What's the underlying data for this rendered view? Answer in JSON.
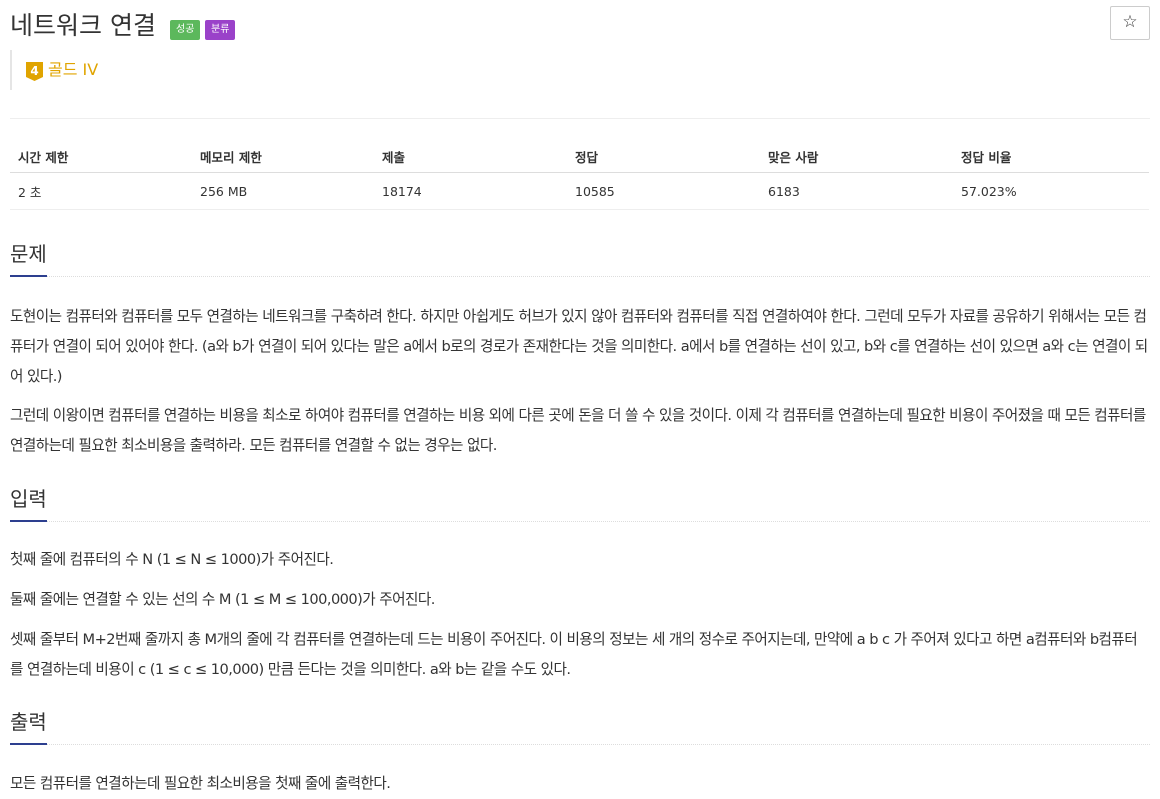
{
  "problem": {
    "title": "네트워크 연결",
    "badges": {
      "success": "성공",
      "category": "분류"
    },
    "star_icon": "☆",
    "tier": {
      "level": "4",
      "name": "골드 IV",
      "color": "#e0a400"
    }
  },
  "info_table": {
    "headers": [
      "시간 제한",
      "메모리 제한",
      "제출",
      "정답",
      "맞은 사람",
      "정답 비율"
    ],
    "values": [
      "2 초",
      "256 MB",
      "18174",
      "10585",
      "6183",
      "57.023%"
    ]
  },
  "sections": {
    "problem": {
      "title": "문제",
      "paragraphs": [
        "도현이는 컴퓨터와 컴퓨터를 모두 연결하는 네트워크를 구축하려 한다. 하지만 아쉽게도 허브가 있지 않아 컴퓨터와 컴퓨터를 직접 연결하여야 한다. 그런데 모두가 자료를 공유하기 위해서는 모든 컴퓨터가 연결이 되어 있어야 한다. (a와 b가 연결이 되어 있다는 말은 a에서 b로의 경로가 존재한다는 것을 의미한다. a에서 b를 연결하는 선이 있고, b와 c를 연결하는 선이 있으면 a와 c는 연결이 되어 있다.)",
        "그런데 이왕이면 컴퓨터를 연결하는 비용을 최소로 하여야 컴퓨터를 연결하는 비용 외에 다른 곳에 돈을 더 쓸 수 있을 것이다. 이제 각 컴퓨터를 연결하는데 필요한 비용이 주어졌을 때 모든 컴퓨터를 연결하는데 필요한 최소비용을 출력하라. 모든 컴퓨터를 연결할 수 없는 경우는 없다."
      ]
    },
    "input": {
      "title": "입력",
      "paragraphs": [
        "첫째 줄에 컴퓨터의 수 N (1 ≤ N ≤ 1000)가 주어진다.",
        "둘째 줄에는 연결할 수 있는 선의 수 M (1 ≤ M ≤ 100,000)가 주어진다.",
        "셋째 줄부터 M+2번째 줄까지 총 M개의 줄에 각 컴퓨터를 연결하는데 드는 비용이 주어진다. 이 비용의 정보는 세 개의 정수로 주어지는데, 만약에 a b c 가 주어져 있다고 하면 a컴퓨터와 b컴퓨터를 연결하는데 비용이 c (1 ≤ c ≤ 10,000) 만큼 든다는 것을 의미한다. a와 b는 같을 수도 있다."
      ]
    },
    "output": {
      "title": "출력",
      "paragraphs": [
        "모든 컴퓨터를 연결하는데 필요한 최소비용을 첫째 줄에 출력한다."
      ]
    }
  }
}
